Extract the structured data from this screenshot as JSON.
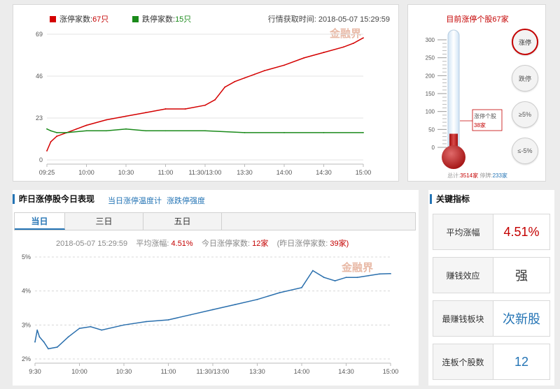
{
  "top": {
    "up_label": "涨停家数:",
    "up_value": "67只",
    "down_label": "跌停家数:",
    "down_value": "15只",
    "fetch_time": "行情获取时间: 2018-05-07 15:29:59",
    "watermark": "金融界",
    "colors": {
      "up": "#d40000",
      "down": "#1a8a1a"
    }
  },
  "thermo": {
    "title": "目前涨停个股67家",
    "callout_line1": "涨停个股",
    "callout_line2": "38家",
    "footer_total_label": "总计:",
    "footer_total_value": "3514家",
    "footer_halt_label": "停牌:",
    "footer_halt_value": "233家",
    "buttons": [
      "涨停",
      "跌停",
      "≥5%",
      "≤-5%"
    ],
    "scale": [
      "300",
      "250",
      "200",
      "150",
      "100",
      "50",
      "0"
    ],
    "level": 38
  },
  "bottom": {
    "section_title": "昨日涨停股今日表现",
    "link_1": "当日涨停温度计",
    "link_2": "涨跌停强度",
    "tabs": [
      "当日",
      "三日",
      "五日"
    ],
    "stats": {
      "datetime": "2018-05-07 15:29:59",
      "avg_label": "平均涨幅:",
      "avg_value": "4.51%",
      "today_label": "今日涨停家数:",
      "today_value": "12家",
      "yest_label": "(昨日涨停家数:",
      "yest_value": "39家)"
    },
    "watermark": "金融界"
  },
  "metrics": {
    "title": "关键指标",
    "rows": [
      {
        "label": "平均涨幅",
        "value": "4.51%",
        "color": "#c40000"
      },
      {
        "label": "赚钱效应",
        "value": "强",
        "color": "#333333"
      },
      {
        "label": "最赚钱板块",
        "value": "次新股",
        "color": "#2474b5"
      },
      {
        "label": "连板个股数",
        "value": "12",
        "color": "#2474b5"
      }
    ]
  },
  "chart_data": [
    {
      "type": "line",
      "x_ticks": [
        "09:25",
        "10:00",
        "10:30",
        "11:00",
        "11:30/13:00",
        "13:30",
        "14:00",
        "14:30",
        "15:00"
      ],
      "y_ticks": [
        "0",
        "23",
        "46",
        "69"
      ],
      "ylim": [
        0,
        69
      ],
      "series": [
        {
          "name": "涨停家数",
          "color": "#d40000",
          "x": [
            0,
            0.1,
            0.25,
            0.5,
            0.75,
            1,
            1.5,
            2,
            2.5,
            3,
            3.5,
            4,
            4.25,
            4.5,
            4.75,
            5,
            5.25,
            5.5,
            6,
            6.5,
            7,
            7.5,
            7.75,
            8
          ],
          "values": [
            5,
            10,
            13,
            15,
            17,
            19,
            22,
            24,
            26,
            28,
            28,
            30,
            33,
            40,
            43,
            45,
            47,
            49,
            52,
            56,
            59,
            62,
            64,
            67
          ]
        },
        {
          "name": "跌停家数",
          "color": "#1a8a1a",
          "x": [
            0,
            0.1,
            0.25,
            0.5,
            1,
            1.5,
            2,
            2.5,
            3,
            4,
            5,
            6,
            7,
            8
          ],
          "values": [
            17,
            16,
            15,
            15,
            16,
            16,
            17,
            16,
            16,
            16,
            15,
            15,
            15,
            15
          ]
        }
      ]
    },
    {
      "type": "line",
      "x_ticks": [
        "9:30",
        "10:00",
        "10:30",
        "11:00",
        "11:30/13:00",
        "13:30",
        "14:00",
        "14:30",
        "15:00"
      ],
      "y_ticks": [
        "2%",
        "3%",
        "4%",
        "5%"
      ],
      "ylim": [
        2,
        5
      ],
      "series": [
        {
          "name": "平均涨幅",
          "color": "#2a6fad",
          "x": [
            0,
            0.05,
            0.1,
            0.2,
            0.3,
            0.5,
            0.75,
            1,
            1.25,
            1.5,
            2,
            2.5,
            3,
            3.5,
            4,
            4.5,
            5,
            5.5,
            6,
            6.25,
            6.5,
            6.75,
            7,
            7.25,
            7.5,
            7.75,
            8
          ],
          "values": [
            2.5,
            2.85,
            2.65,
            2.5,
            2.3,
            2.35,
            2.65,
            2.9,
            2.95,
            2.85,
            3.0,
            3.1,
            3.15,
            3.3,
            3.45,
            3.6,
            3.75,
            3.95,
            4.1,
            4.6,
            4.4,
            4.3,
            4.4,
            4.4,
            4.45,
            4.5,
            4.51
          ]
        }
      ]
    }
  ]
}
